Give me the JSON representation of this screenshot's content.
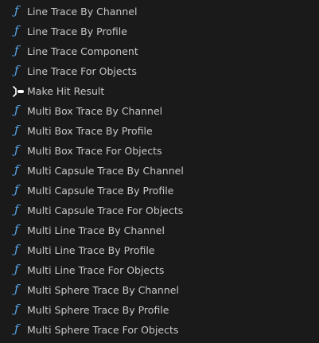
{
  "items": [
    {
      "label": "Line Trace By Channel",
      "icon": "function-icon"
    },
    {
      "label": "Line Trace By Profile",
      "icon": "function-icon"
    },
    {
      "label": "Line Trace Component",
      "icon": "function-icon"
    },
    {
      "label": "Line Trace For Objects",
      "icon": "function-icon"
    },
    {
      "label": "Make Hit Result",
      "icon": "make-struct-icon"
    },
    {
      "label": "Multi Box Trace By Channel",
      "icon": "function-icon"
    },
    {
      "label": "Multi Box Trace By Profile",
      "icon": "function-icon"
    },
    {
      "label": "Multi Box Trace For Objects",
      "icon": "function-icon"
    },
    {
      "label": "Multi Capsule Trace By Channel",
      "icon": "function-icon"
    },
    {
      "label": "Multi Capsule Trace By Profile",
      "icon": "function-icon"
    },
    {
      "label": "Multi Capsule Trace For Objects",
      "icon": "function-icon"
    },
    {
      "label": "Multi Line Trace By Channel",
      "icon": "function-icon"
    },
    {
      "label": "Multi Line Trace By Profile",
      "icon": "function-icon"
    },
    {
      "label": "Multi Line Trace For Objects",
      "icon": "function-icon"
    },
    {
      "label": "Multi Sphere Trace By Channel",
      "icon": "function-icon"
    },
    {
      "label": "Multi Sphere Trace By Profile",
      "icon": "function-icon"
    },
    {
      "label": "Multi Sphere Trace For Objects",
      "icon": "function-icon"
    }
  ],
  "colors": {
    "background": "#1a1a1a",
    "text": "#c8c8c8",
    "function_icon": "#58a5e8",
    "make_icon": "#ffffff"
  }
}
